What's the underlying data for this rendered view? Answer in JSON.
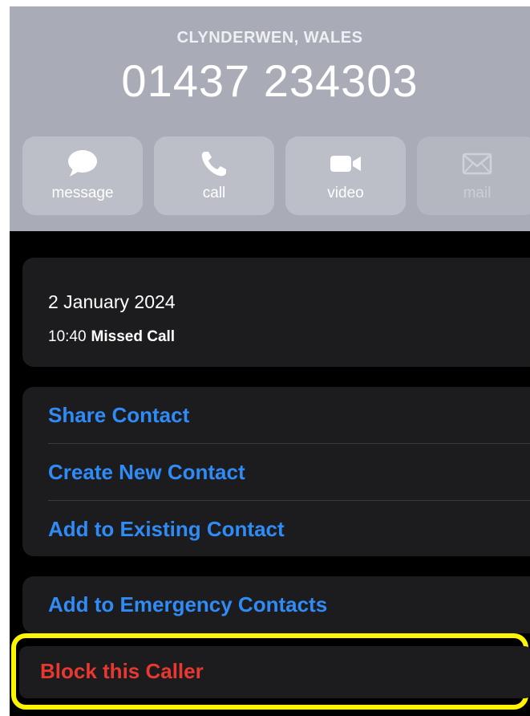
{
  "header": {
    "location": "CLYNDERWEN, WALES",
    "number": "01437 234303"
  },
  "actions": [
    {
      "label": "message",
      "icon": "message-bubble-icon",
      "enabled": true
    },
    {
      "label": "call",
      "icon": "phone-icon",
      "enabled": true
    },
    {
      "label": "video",
      "icon": "video-camera-icon",
      "enabled": true
    },
    {
      "label": "mail",
      "icon": "envelope-icon",
      "enabled": false
    }
  ],
  "recent": {
    "date": "2 January 2024",
    "time": "10:40",
    "status": "Missed Call"
  },
  "contact_options": [
    "Share Contact",
    "Create New Contact",
    "Add to Existing Contact"
  ],
  "emergency": "Add to Emergency Contacts",
  "block": "Block this Caller",
  "colors": {
    "header_bg": "#a9acb6",
    "link_blue": "#2f8bf5",
    "destructive_red": "#e8382f",
    "highlight_yellow": "#fcf400"
  }
}
